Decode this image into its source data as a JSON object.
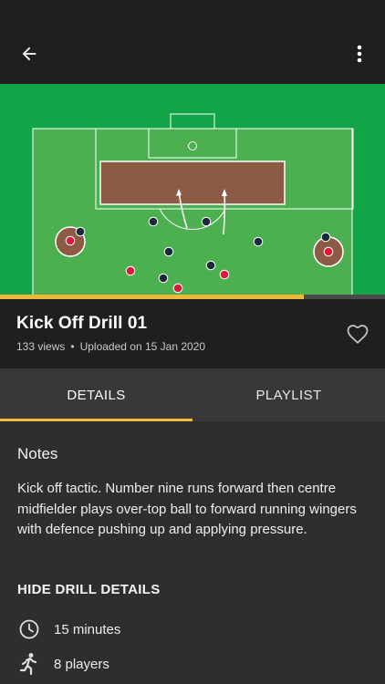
{
  "appbar": {
    "back_icon": "arrow-back-icon",
    "more_icon": "more-vert-icon"
  },
  "video": {
    "progress_fraction": 0.79,
    "accent_color": "#f0b83a"
  },
  "drill": {
    "title": "Kick Off Drill 01",
    "views": "133 views",
    "separator": "•",
    "uploaded": "Uploaded on 15 Jan 2020",
    "favorite_icon": "heart-outline-icon"
  },
  "tabs": [
    {
      "label": "DETAILS",
      "active": true
    },
    {
      "label": "PLAYLIST",
      "active": false
    }
  ],
  "details": {
    "notes_heading": "Notes",
    "notes_text": "Kick off tactic. Number nine runs forward then centre midfielder plays over-top ball to forward running wingers with defence pushing up and applying pressure.",
    "hide_label": "HIDE DRILL DETAILS",
    "rows": [
      {
        "icon": "clock-icon",
        "text": "15 minutes"
      },
      {
        "icon": "running-person-icon",
        "text": "8 players"
      }
    ]
  }
}
